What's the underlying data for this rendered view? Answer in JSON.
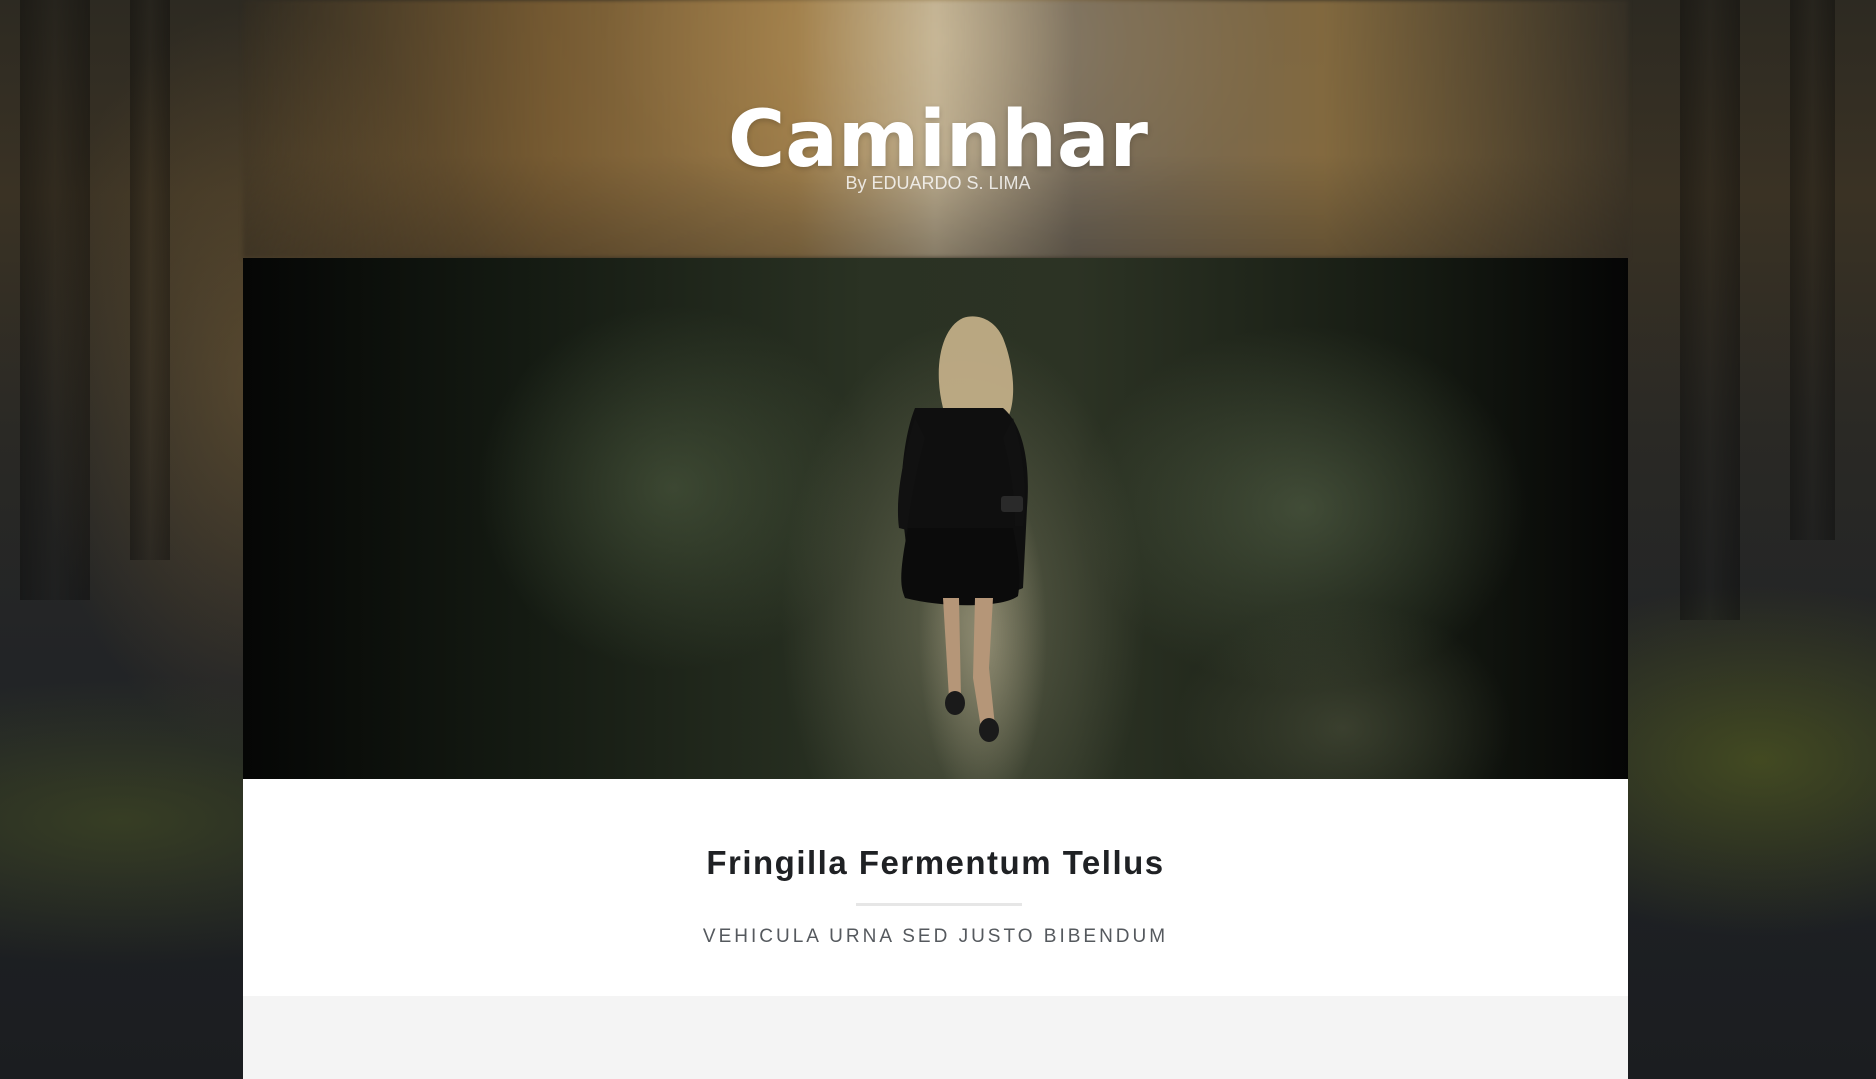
{
  "header": {
    "title": "Caminhar",
    "byline": "By EDUARDO S. LIMA"
  },
  "post": {
    "title": "Fringilla Fermentum Tellus",
    "subtitle": "VEHICULA URNA SED JUSTO BIBENDUM"
  },
  "colors": {
    "title_text": "#ffffff",
    "post_title": "#1f2124",
    "post_subtitle": "#55595e",
    "card_background": "#ffffff",
    "card_lower_background": "#f4f4f4"
  }
}
